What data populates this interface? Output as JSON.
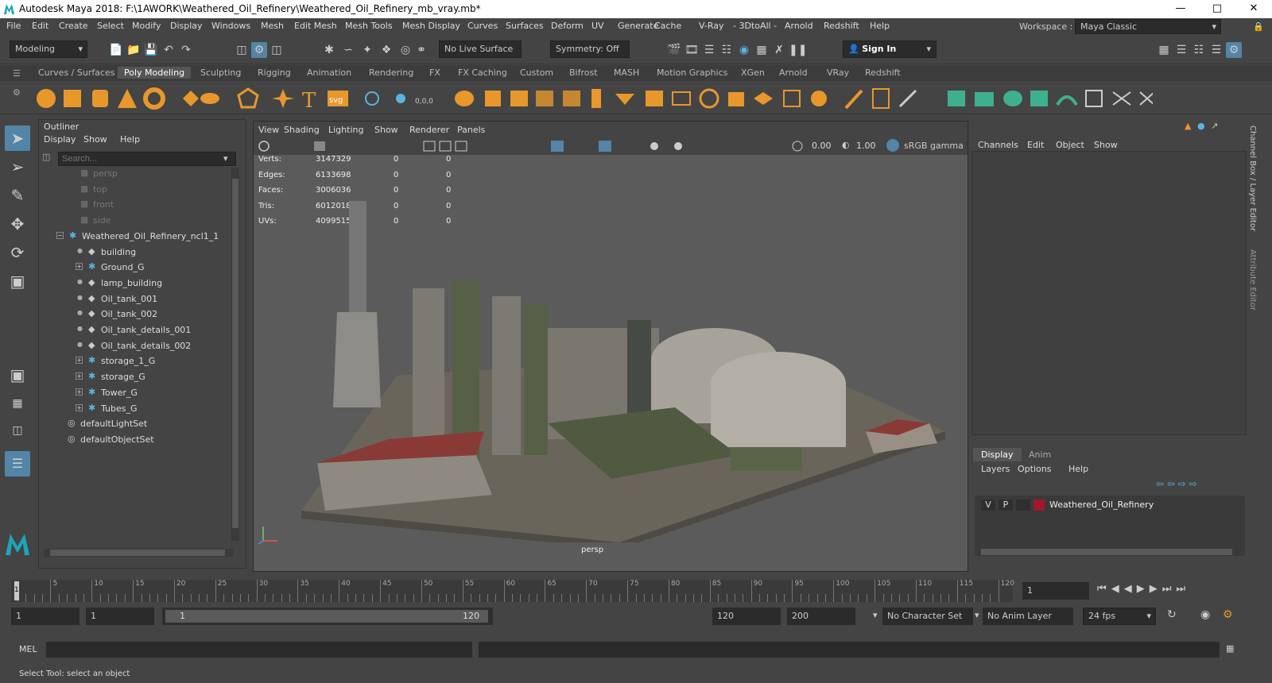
{
  "window": {
    "title": "Autodesk Maya 2018: F:\\1AWORK\\Weathered_Oil_Refinery\\Weathered_Oil_Refinery_mb_vray.mb*"
  },
  "menus": [
    "File",
    "Edit",
    "Create",
    "Select",
    "Modify",
    "Display",
    "Windows",
    "Mesh",
    "Edit Mesh",
    "Mesh Tools",
    "Mesh Display",
    "Curves",
    "Surfaces",
    "Deform",
    "UV",
    "Generate",
    "Cache",
    "V-Ray",
    "- 3DtoAll -",
    "Arnold",
    "Redshift",
    "Help"
  ],
  "workspace": {
    "label": "Workspace :",
    "value": "Maya Classic"
  },
  "status": {
    "mode": "Modeling",
    "live_surface": "No Live Surface",
    "symmetry": "Symmetry: Off",
    "sign_in": "Sign In"
  },
  "shelf_tabs": [
    "Curves / Surfaces",
    "Poly Modeling",
    "Sculpting",
    "Rigging",
    "Animation",
    "Rendering",
    "FX",
    "FX Caching",
    "Custom",
    "Bifrost",
    "MASH",
    "Motion Graphics",
    "XGen",
    "Arnold",
    "VRay",
    "Redshift"
  ],
  "shelf_active": "Poly Modeling",
  "outliner": {
    "title": "Outliner",
    "menu": [
      "Display",
      "Show",
      "Help"
    ],
    "search_placeholder": "Search...",
    "items": [
      {
        "label": "persp",
        "kind": "camera"
      },
      {
        "label": "top",
        "kind": "camera"
      },
      {
        "label": "front",
        "kind": "camera"
      },
      {
        "label": "side",
        "kind": "camera"
      },
      {
        "label": "Weathered_Oil_Refinery_ncl1_1",
        "kind": "group"
      },
      {
        "label": "building",
        "kind": "mesh"
      },
      {
        "label": "Ground_G",
        "kind": "group"
      },
      {
        "label": "lamp_building",
        "kind": "mesh"
      },
      {
        "label": "Oil_tank_001",
        "kind": "mesh"
      },
      {
        "label": "Oil_tank_002",
        "kind": "mesh"
      },
      {
        "label": "Oil_tank_details_001",
        "kind": "mesh"
      },
      {
        "label": "Oil_tank_details_002",
        "kind": "mesh"
      },
      {
        "label": "storage_1_G",
        "kind": "group"
      },
      {
        "label": "storage_G",
        "kind": "group"
      },
      {
        "label": "Tower_G",
        "kind": "group"
      },
      {
        "label": "Tubes_G",
        "kind": "group"
      },
      {
        "label": "defaultLightSet",
        "kind": "set"
      },
      {
        "label": "defaultObjectSet",
        "kind": "set"
      }
    ]
  },
  "viewport": {
    "menu": [
      "View",
      "Shading",
      "Lighting",
      "Show",
      "Renderer",
      "Panels"
    ],
    "exposure": "0.00",
    "gamma": "1.00",
    "color_space": "sRGB gamma",
    "camera_label": "persp",
    "hud": [
      {
        "label": "Verts:",
        "v1": "3147329",
        "v2": "0",
        "v3": "0"
      },
      {
        "label": "Edges:",
        "v1": "6133698",
        "v2": "0",
        "v3": "0"
      },
      {
        "label": "Faces:",
        "v1": "3006036",
        "v2": "0",
        "v3": "0"
      },
      {
        "label": "Tris:",
        "v1": "6012018",
        "v2": "0",
        "v3": "0"
      },
      {
        "label": "UVs:",
        "v1": "4099515",
        "v2": "0",
        "v3": "0"
      }
    ]
  },
  "channel_box": {
    "menu": [
      "Channels",
      "Edit",
      "Object",
      "Show"
    ],
    "side_tabs": [
      "Channel Box / Layer Editor",
      "Attribute Editor"
    ],
    "layer_tabs": [
      "Display",
      "Anim"
    ],
    "layer_menu": [
      "Layers",
      "Options",
      "Help"
    ],
    "layer": {
      "v": "V",
      "p": "P",
      "name": "Weathered_Oil_Refinery",
      "color": "#a0182e"
    }
  },
  "timeline": {
    "ticks": [
      "5",
      "10",
      "15",
      "20",
      "25",
      "30",
      "35",
      "40",
      "45",
      "50",
      "55",
      "60",
      "65",
      "70",
      "75",
      "80",
      "85",
      "90",
      "95",
      "100",
      "105",
      "110",
      "115",
      "120"
    ],
    "current_frame": "1",
    "start_marker": "1"
  },
  "range": {
    "start": "1",
    "playback_start": "1",
    "slider_start": "1",
    "slider_end": "120",
    "playback_end": "120",
    "end": "200",
    "character_set": "No Character Set",
    "anim_layer": "No Anim Layer",
    "fps": "24 fps"
  },
  "mel": {
    "label": "MEL"
  },
  "help_line": "Select Tool: select an object",
  "colors": {
    "accent": "#5285a6",
    "active_tab": "#5d5d5d",
    "shelf_orange": "#e8972c",
    "shelf_green": "#3fb08f"
  }
}
